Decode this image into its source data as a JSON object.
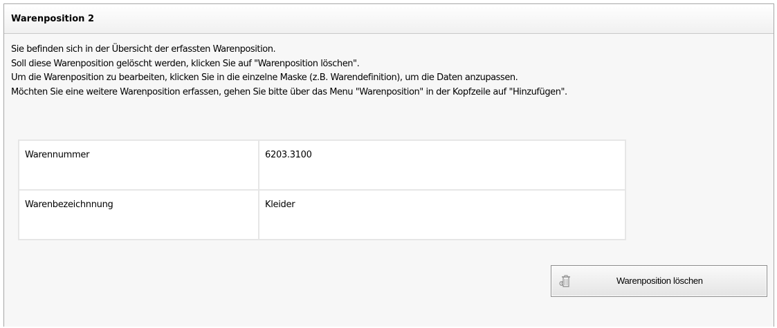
{
  "panel": {
    "title": "Warenposition 2"
  },
  "instructions": [
    "Sie befinden sich in der Übersicht der erfassten Warenposition.",
    "Soll diese Warenposition gelöscht werden, klicken Sie auf \"Warenposition löschen\".",
    "Um die Warenposition zu bearbeiten, klicken Sie in die einzelne Maske (z.B. Warendefinition), um die Daten anzupassen.",
    "Möchten Sie eine weitere Warenposition erfassen, gehen Sie bitte über das Menu \"Warenposition\" in der Kopfzeile auf \"Hinzufügen\"."
  ],
  "table": {
    "rows": [
      {
        "label": "Warennummer",
        "value": "6203.3100"
      },
      {
        "label": "Warenbezeichnnung",
        "value": "Kleider"
      }
    ]
  },
  "actions": {
    "delete_label": "Warenposition löschen",
    "delete_icon": "trash-can-icon"
  }
}
